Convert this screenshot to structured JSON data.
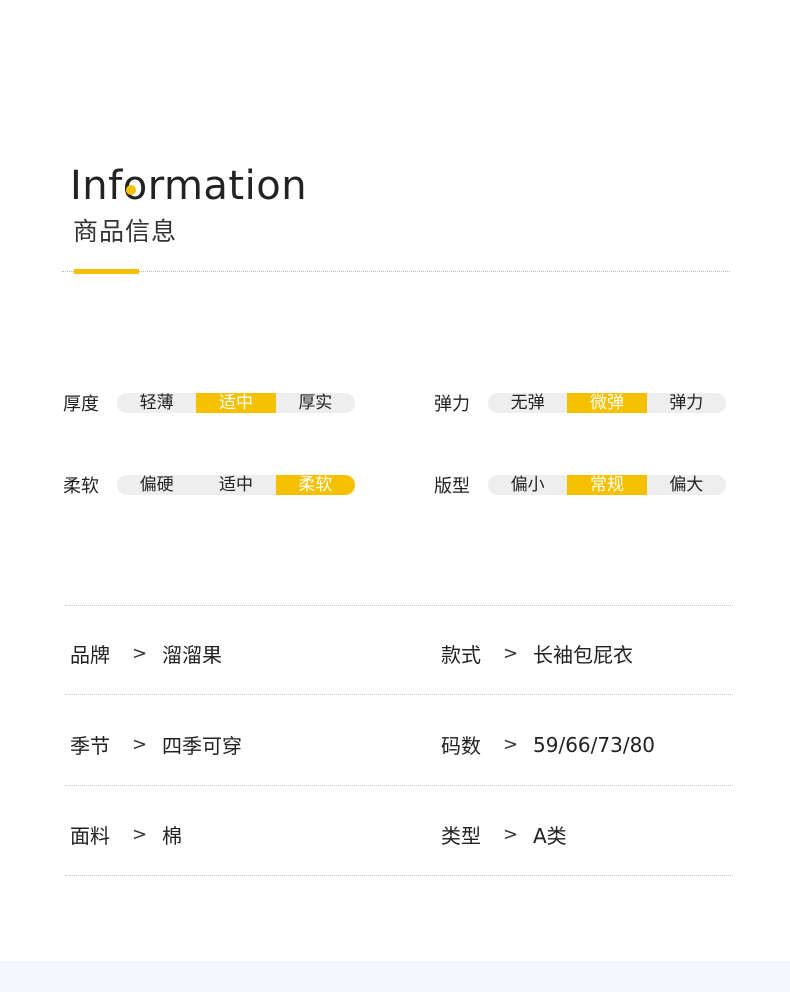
{
  "header": {
    "title": "Information",
    "subtitle": "商品信息",
    "accent_color": "#f5c000"
  },
  "scales": [
    {
      "label": "厚度",
      "options": [
        "轻薄",
        "适中",
        "厚实"
      ],
      "selected": 1
    },
    {
      "label": "弹力",
      "options": [
        "无弹",
        "微弹",
        "弹力"
      ],
      "selected": 1
    },
    {
      "label": "柔软",
      "options": [
        "偏硬",
        "适中",
        "柔软"
      ],
      "selected": 2
    },
    {
      "label": "版型",
      "options": [
        "偏小",
        "常规",
        "偏大"
      ],
      "selected": 1
    }
  ],
  "specs": [
    [
      {
        "key": "品牌",
        "arrow": ">",
        "value": "溜溜果"
      },
      {
        "key": "款式",
        "arrow": ">",
        "value": "长袖包屁衣"
      }
    ],
    [
      {
        "key": "季节",
        "arrow": ">",
        "value": "四季可穿"
      },
      {
        "key": "码数",
        "arrow": ">",
        "value": "59/66/73/80"
      }
    ],
    [
      {
        "key": "面料",
        "arrow": ">",
        "value": "棉"
      },
      {
        "key": "类型",
        "arrow": ">",
        "value": "A类"
      }
    ]
  ]
}
